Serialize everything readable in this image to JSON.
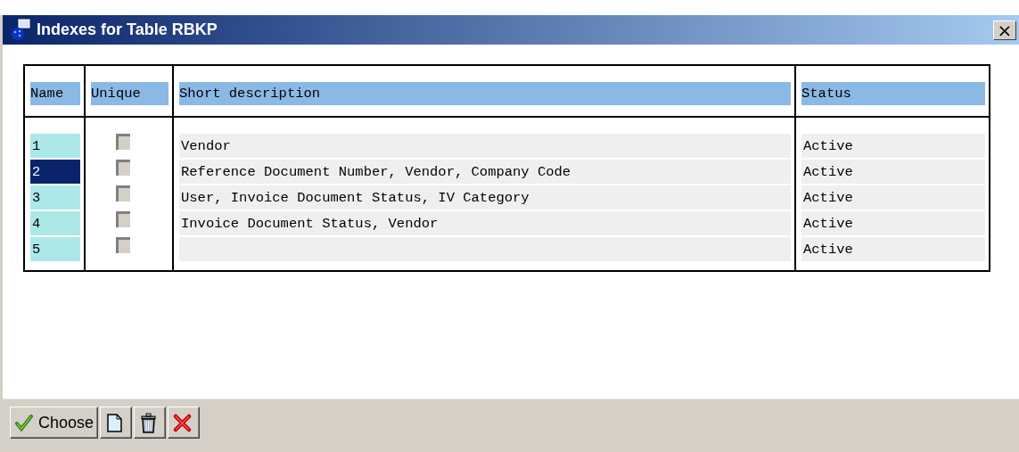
{
  "window": {
    "title": "Indexes for Table RBKP",
    "close": "×"
  },
  "table": {
    "columns": [
      "Name",
      "Unique",
      "Short description",
      "Status"
    ],
    "rows": [
      {
        "name": "1",
        "unique": false,
        "description": "Vendor",
        "status": "Active",
        "selected": false
      },
      {
        "name": "2",
        "unique": false,
        "description": "Reference Document Number, Vendor, Company Code",
        "status": "Active",
        "selected": true
      },
      {
        "name": "3",
        "unique": false,
        "description": "User, Invoice Document Status, IV Category",
        "status": "Active",
        "selected": false
      },
      {
        "name": "4",
        "unique": false,
        "description": "Invoice Document Status, Vendor",
        "status": "Active",
        "selected": false
      },
      {
        "name": "5",
        "unique": false,
        "description": "",
        "status": "Active",
        "selected": false
      }
    ]
  },
  "buttons": [
    {
      "kind": "choose",
      "label": "Choose"
    },
    {
      "kind": "new"
    },
    {
      "kind": "delete"
    },
    {
      "kind": "cancel"
    }
  ]
}
